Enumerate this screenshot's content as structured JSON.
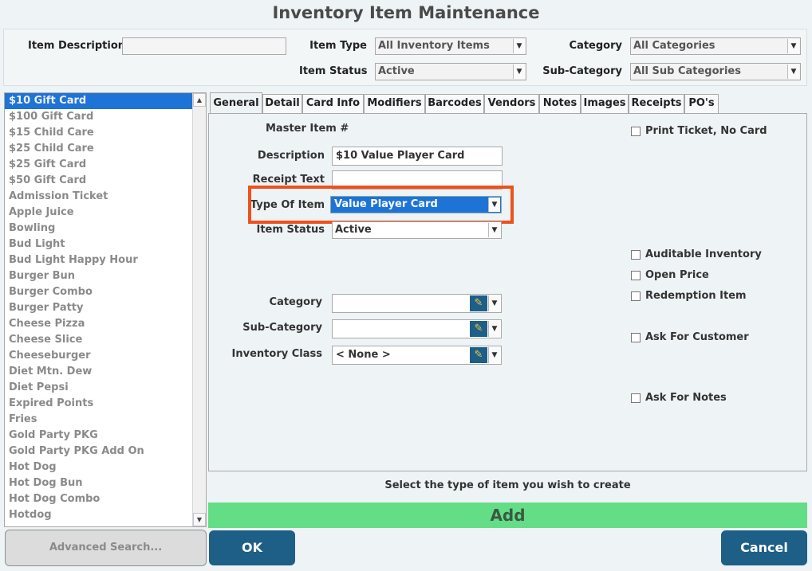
{
  "window": {
    "title": "Inventory Item Maintenance"
  },
  "filters": {
    "item_description_label": "Item Description",
    "item_description_value": "",
    "item_type_label": "Item Type",
    "item_type_value": "All Inventory Items",
    "category_label": "Category",
    "category_value": "All Categories",
    "item_status_label": "Item Status",
    "item_status_value": "Active",
    "sub_category_label": "Sub-Category",
    "sub_category_value": "All Sub Categories"
  },
  "item_list": [
    "$10 Gift Card",
    "$100 Gift Card",
    "$15 Child Care",
    "$25 Child Care",
    "$25 Gift Card",
    "$50 Gift Card",
    "Admission Ticket",
    "Apple Juice",
    "Bowling",
    "Bud Light",
    "Bud Light Happy Hour",
    "Burger Bun",
    "Burger Combo",
    "Burger Patty",
    "Cheese Pizza",
    "Cheese Slice",
    "Cheeseburger",
    "Diet Mtn. Dew",
    "Diet Pepsi",
    "Expired Points",
    "Fries",
    "Gold Party PKG",
    "Gold Party PKG Add On",
    "Hot Dog",
    "Hot Dog Bun",
    "Hot Dog Combo",
    "Hotdog"
  ],
  "selected_item": "$10 Gift Card",
  "tabs": [
    "General",
    "Detail",
    "Card Info",
    "Modifiers",
    "Barcodes",
    "Vendors",
    "Notes",
    "Images",
    "Receipts",
    "PO's"
  ],
  "active_tab": "General",
  "general": {
    "master_item_label": "Master Item #",
    "master_item_value": "",
    "description_label": "Description",
    "description_value": "$10 Value Player Card",
    "receipt_text_label": "Receipt Text",
    "receipt_text_value": "",
    "type_of_item_label": "Type Of Item",
    "type_of_item_value": "Value Player Card",
    "item_status_label": "Item Status",
    "item_status_value": "Active",
    "category_label": "Category",
    "category_value": "",
    "sub_category_label": "Sub-Category",
    "sub_category_value": "",
    "inventory_class_label": "Inventory Class",
    "inventory_class_value": "< None >"
  },
  "checkboxes": {
    "print_ticket": "Print Ticket, No Card",
    "auditable_inventory": "Auditable Inventory",
    "open_price": "Open Price",
    "redemption_item": "Redemption Item",
    "ask_for_customer": "Ask For Customer",
    "ask_for_notes": "Ask For Notes"
  },
  "footer": {
    "hint": "Select the type of item you wish to create",
    "add_label": "Add",
    "advanced_search_label": "Advanced Search...",
    "ok_label": "OK",
    "cancel_label": "Cancel"
  },
  "icons": {
    "dropdown_arrow": "▼",
    "scroll_up": "▲",
    "scroll_down": "▼",
    "edit_pencil": "✎"
  },
  "colors": {
    "accent_blue": "#1e73d6",
    "button_navy": "#1d5f86",
    "add_green": "#64dd87",
    "highlight_orange": "#f0501c"
  }
}
